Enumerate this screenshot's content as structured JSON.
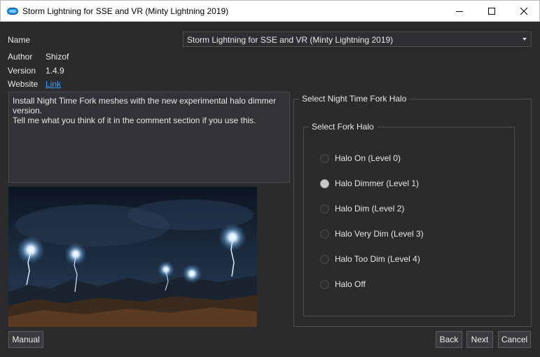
{
  "window": {
    "title": "Storm Lightning for SSE and VR (Minty Lightning 2019)"
  },
  "info": {
    "name_label": "Name",
    "name_value": "Storm Lightning for SSE and VR (Minty Lightning 2019)",
    "author_label": "Author",
    "author_value": "Shizof",
    "version_label": "Version",
    "version_value": "1.4.9",
    "website_label": "Website",
    "website_link": "Link"
  },
  "description": "Install Night Time Fork meshes with the new experimental halo dimmer version.\nTell me what you think of it in the comment section if you use this.",
  "step": {
    "group_title": "Select Night Time Fork Halo",
    "sub_group_title": "Select Fork Halo",
    "options": [
      {
        "label": "Halo On (Level 0)",
        "selected": false
      },
      {
        "label": "Halo Dimmer (Level 1)",
        "selected": true
      },
      {
        "label": "Halo Dim (Level 2)",
        "selected": false
      },
      {
        "label": "Halo Very Dim (Level 3)",
        "selected": false
      },
      {
        "label": "Halo Too Dim (Level 4)",
        "selected": false
      },
      {
        "label": "Halo Off",
        "selected": false
      }
    ]
  },
  "buttons": {
    "manual": "Manual",
    "back": "Back",
    "next": "Next",
    "cancel": "Cancel"
  },
  "colors": {
    "background": "#2b2b2e",
    "link": "#3e9cff",
    "radio_checked": "#c8c8c8"
  }
}
